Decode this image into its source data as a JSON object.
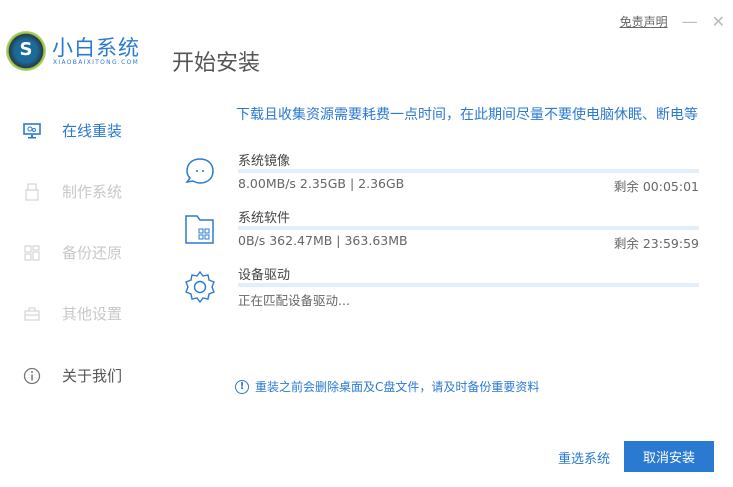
{
  "header": {
    "brand": "小白系统",
    "brand_sub": "XIAOBAIXITONG.COM",
    "page_title": "开始安装",
    "disclaimer": "免责声明",
    "minimize": "—",
    "close": "✕"
  },
  "sidebar": {
    "items": [
      {
        "label": "在线重装",
        "icon": "monitor-icon",
        "state": "active"
      },
      {
        "label": "制作系统",
        "icon": "usb-icon",
        "state": "disabled"
      },
      {
        "label": "备份还原",
        "icon": "backup-icon",
        "state": "disabled"
      },
      {
        "label": "其他设置",
        "icon": "toolbox-icon",
        "state": "disabled"
      },
      {
        "label": "关于我们",
        "icon": "info-icon",
        "state": "normal"
      }
    ]
  },
  "main": {
    "notice": "下载且收集资源需要耗费一点时间，在此期间尽量不要使电脑休眠、断电等",
    "tasks": [
      {
        "title": "系统镜像",
        "stat": "8.00MB/s 2.35GB | 2.36GB",
        "remaining": "剩余 00:05:01",
        "progress": 0,
        "icon": "chat-bubble-icon"
      },
      {
        "title": "系统软件",
        "stat": "0B/s 362.47MB | 363.63MB",
        "remaining": "剩余 23:59:59",
        "progress": 0,
        "icon": "folder-apps-icon"
      },
      {
        "title": "设备驱动",
        "stat": "正在匹配设备驱动...",
        "remaining": "",
        "progress": 0,
        "icon": "gear-icon"
      }
    ],
    "warning": "重装之前会删除桌面及C盘文件，请及时备份重要资料",
    "reselect": "重选系统",
    "cancel": "取消安装"
  },
  "colors": {
    "accent": "#2a7ad2",
    "track": "#e3eefb"
  }
}
